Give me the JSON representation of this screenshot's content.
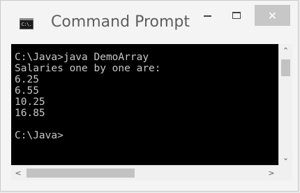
{
  "window": {
    "title": "Command Prompt",
    "icon": "cmd-icon",
    "icon_text": "C:\\."
  },
  "controls": {
    "minimize_icon": "minimize-icon",
    "maximize_icon": "maximize-icon",
    "close_glyph": "✕"
  },
  "console": {
    "lines": [
      "C:\\Java>java DemoArray",
      "Salaries one by one are:",
      "6.25",
      "6.55",
      "10.25",
      "16.85",
      "",
      "C:\\Java>"
    ],
    "text_color": "#c8c8c8",
    "background": "#000000"
  },
  "scrollbars": {
    "up_glyph": "⌃",
    "down_glyph": "⌄",
    "left_glyph": "<",
    "right_glyph": ">"
  }
}
